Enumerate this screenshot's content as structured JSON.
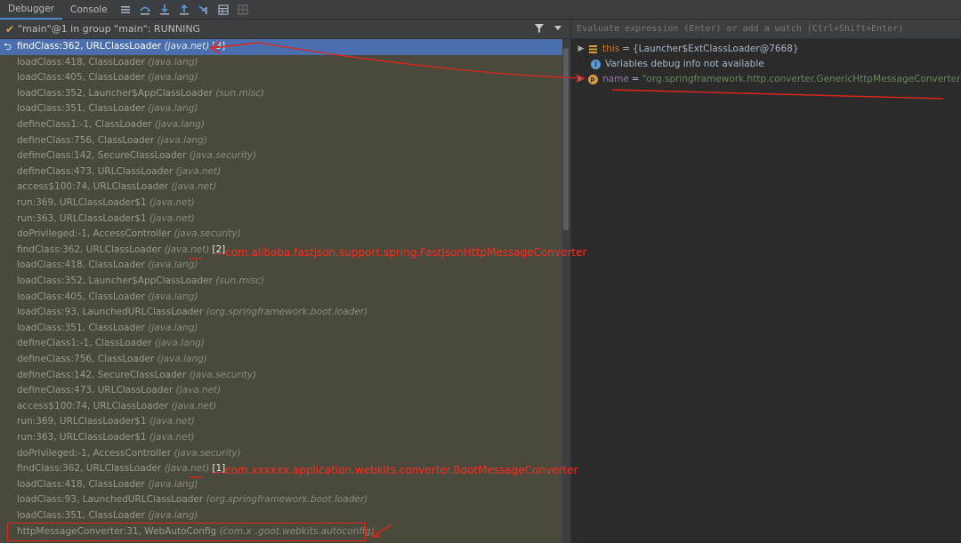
{
  "toolbar": {
    "tabs": [
      "Debugger",
      "Console"
    ],
    "icons": [
      "frames-layout-icon",
      "step-over-icon",
      "step-into-icon",
      "step-out-icon",
      "run-to-cursor-icon",
      "evaluate-icon",
      "trace-icon"
    ]
  },
  "thread": {
    "label": "\"main\"@1 in group \"main\": RUNNING"
  },
  "frames": [
    {
      "method": "findClass:362, URLClassLoader",
      "pkg": "(java.net)",
      "marker": "[3]",
      "selected": true
    },
    {
      "method": "loadClass:418, ClassLoader",
      "pkg": "(java.lang)"
    },
    {
      "method": "loadClass:405, ClassLoader",
      "pkg": "(java.lang)"
    },
    {
      "method": "loadClass:352, Launcher$AppClassLoader",
      "pkg": "(sun.misc)"
    },
    {
      "method": "loadClass:351, ClassLoader",
      "pkg": "(java.lang)"
    },
    {
      "method": "defineClass1:-1, ClassLoader",
      "pkg": "(java.lang)"
    },
    {
      "method": "defineClass:756, ClassLoader",
      "pkg": "(java.lang)"
    },
    {
      "method": "defineClass:142, SecureClassLoader",
      "pkg": "(java.security)"
    },
    {
      "method": "defineClass:473, URLClassLoader",
      "pkg": "(java.net)"
    },
    {
      "method": "access$100:74, URLClassLoader",
      "pkg": "(java.net)"
    },
    {
      "method": "run:369, URLClassLoader$1",
      "pkg": "(java.net)"
    },
    {
      "method": "run:363, URLClassLoader$1",
      "pkg": "(java.net)"
    },
    {
      "method": "doPrivileged:-1, AccessController",
      "pkg": "(java.security)"
    },
    {
      "method": "findClass:362, URLClassLoader",
      "pkg": "(java.net)",
      "marker": "[2]"
    },
    {
      "method": "loadClass:418, ClassLoader",
      "pkg": "(java.lang)"
    },
    {
      "method": "loadClass:352, Launcher$AppClassLoader",
      "pkg": "(sun.misc)"
    },
    {
      "method": "loadClass:405, ClassLoader",
      "pkg": "(java.lang)"
    },
    {
      "method": "loadClass:93, LaunchedURLClassLoader",
      "pkg": "(org.springframework.boot.loader)"
    },
    {
      "method": "loadClass:351, ClassLoader",
      "pkg": "(java.lang)"
    },
    {
      "method": "defineClass1:-1, ClassLoader",
      "pkg": "(java.lang)"
    },
    {
      "method": "defineClass:756, ClassLoader",
      "pkg": "(java.lang)"
    },
    {
      "method": "defineClass:142, SecureClassLoader",
      "pkg": "(java.security)"
    },
    {
      "method": "defineClass:473, URLClassLoader",
      "pkg": "(java.net)"
    },
    {
      "method": "access$100:74, URLClassLoader",
      "pkg": "(java.net)"
    },
    {
      "method": "run:369, URLClassLoader$1",
      "pkg": "(java.net)"
    },
    {
      "method": "run:363, URLClassLoader$1",
      "pkg": "(java.net)"
    },
    {
      "method": "doPrivileged:-1, AccessController",
      "pkg": "(java.security)"
    },
    {
      "method": "findClass:362, URLClassLoader",
      "pkg": "(java.net)",
      "marker": "[1]"
    },
    {
      "method": "loadClass:418, ClassLoader",
      "pkg": "(java.lang)"
    },
    {
      "method": "loadClass:93, LaunchedURLClassLoader",
      "pkg": "(org.springframework.boot.loader)"
    },
    {
      "method": "loadClass:351, ClassLoader",
      "pkg": "(java.lang)"
    },
    {
      "method": "httpMessageConverter:31, WebAutoConfig",
      "pkg": "(com.x  .goot.webkits.autoconfig)"
    }
  ],
  "variables": {
    "eval_placeholder": "Evaluate expression (Enter) or add a watch (Ctrl+Shift+Enter)",
    "this": {
      "name": "this",
      "eq": "=",
      "value": "{Launcher$ExtClassLoader@7668}"
    },
    "info": "Variables debug info not available",
    "param": {
      "name": "name",
      "eq": "=",
      "value": "\"org.springframework.http.converter.GenericHttpMessageConverter\""
    }
  },
  "annotations": {
    "note2": "com.alibaba.fastjson.support.spring.FastJsonHttpMessageConverter",
    "note1": "com.xxxxxx.application.webkits.converter.BootMessageConverter",
    "color": "#ff2a1f"
  },
  "colors": {
    "selection": "#4b6eaf",
    "frame_bg": "#4a4a3c",
    "panel_bg": "#2b2b2b",
    "string": "#6a8759",
    "keyword": "#cc7832"
  }
}
